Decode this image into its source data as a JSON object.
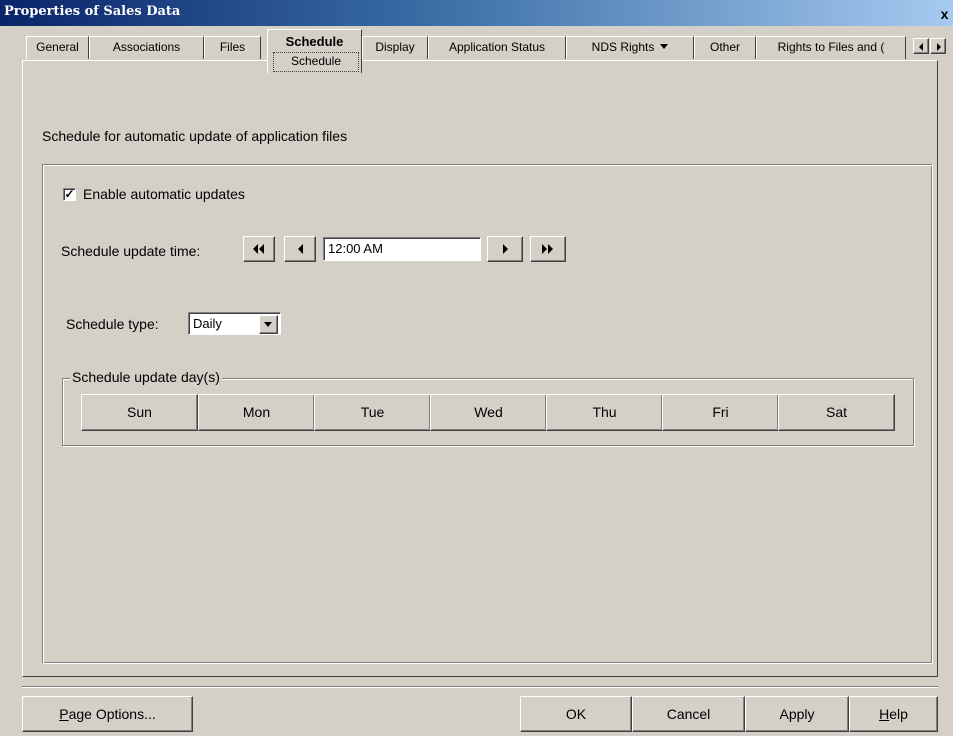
{
  "window": {
    "title": "Properties of Sales Data",
    "close_glyph": "x"
  },
  "tabs": [
    {
      "label": "General"
    },
    {
      "label": "Associations"
    },
    {
      "label": "Files"
    },
    {
      "label": "Schedule",
      "sublabel": "Schedule",
      "active": true
    },
    {
      "label": "Display"
    },
    {
      "label": "Application Status"
    },
    {
      "label": "NDS Rights"
    },
    {
      "label": "Other"
    },
    {
      "label": "Rights to Files and ("
    }
  ],
  "schedule": {
    "heading": "Schedule for automatic update of application files",
    "enable_label": "Enable automatic updates",
    "enable_checked": true,
    "checkmark": "✓",
    "time_label": "Schedule update time:",
    "time_value": "12:00 AM",
    "type_label": "Schedule type:",
    "type_value": "Daily",
    "days_legend": "Schedule update day(s)",
    "days": [
      "Sun",
      "Mon",
      "Tue",
      "Wed",
      "Thu",
      "Fri",
      "Sat"
    ]
  },
  "footer": {
    "page_options": {
      "first": "P",
      "rest": "age Options..."
    },
    "ok": "OK",
    "cancel": "Cancel",
    "apply": "Apply",
    "help": {
      "first": "H",
      "rest": "elp"
    }
  },
  "icons": {
    "rewind": "rewind-icon",
    "step_back": "step-back-icon",
    "step_forward": "step-forward-icon",
    "fast_forward": "fast-forward-icon",
    "dropdown": "chevron-down-icon"
  },
  "colors": {
    "titlebar_start": "#0a246a",
    "titlebar_end": "#a6caf0",
    "face": "#d4d0c8"
  }
}
